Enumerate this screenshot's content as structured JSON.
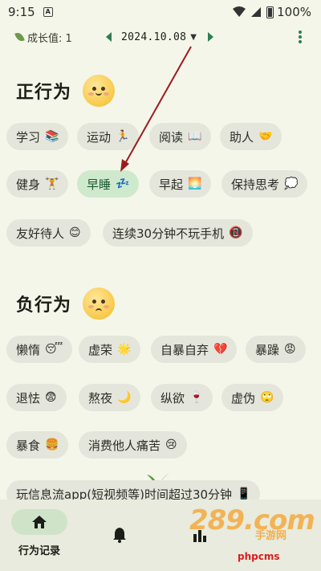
{
  "status_bar": {
    "time": "9:15",
    "notification_letter": "A",
    "battery": "100%"
  },
  "header": {
    "growth_label": "成长值: 1",
    "date": "2024.10.08",
    "icons": [
      "leaf-icon",
      "arrow-left-icon",
      "chevron-down-icon",
      "arrow-right-icon",
      "more-vertical-icon"
    ],
    "accent_color": "#2e7d4f"
  },
  "positive": {
    "title": "正行为",
    "chips": [
      {
        "label": "学习",
        "emoji": "📚",
        "selected": false
      },
      {
        "label": "运动",
        "emoji": "🏃",
        "selected": false
      },
      {
        "label": "阅读",
        "emoji": "📖",
        "selected": false
      },
      {
        "label": "助人",
        "emoji": "🤝",
        "selected": false
      },
      {
        "label": "健身",
        "emoji": "🏋",
        "selected": false
      },
      {
        "label": "早睡",
        "emoji": "💤",
        "selected": true
      },
      {
        "label": "早起",
        "emoji": "🌅",
        "selected": false
      },
      {
        "label": "保持思考",
        "emoji": "💭",
        "selected": false
      },
      {
        "label": "友好待人",
        "emoji": "😊",
        "selected": false
      },
      {
        "label": "连续30分钟不玩手机",
        "emoji": "📵",
        "selected": false
      }
    ]
  },
  "negative": {
    "title": "负行为",
    "chips": [
      {
        "label": "懒惰",
        "emoji": "😴"
      },
      {
        "label": "虚荣",
        "emoji": "🌟"
      },
      {
        "label": "自暴自弃",
        "emoji": "💔"
      },
      {
        "label": "暴躁",
        "emoji": "😡"
      },
      {
        "label": "退怯",
        "emoji": "😨"
      },
      {
        "label": "熬夜",
        "emoji": "🌙"
      },
      {
        "label": "纵欲",
        "emoji": "🍷"
      },
      {
        "label": "虚伪",
        "emoji": "🙄"
      },
      {
        "label": "暴食",
        "emoji": "🍔"
      },
      {
        "label": "消费他人痛苦",
        "emoji": "😢"
      },
      {
        "label": "玩信息流app(短视频等)时间超过30分钟",
        "emoji": "📱"
      }
    ]
  },
  "bottom_nav": {
    "items": [
      {
        "label": "行为记录",
        "icon": "home-icon",
        "active": true
      },
      {
        "label": "",
        "icon": "bell-icon",
        "active": false
      },
      {
        "label": "",
        "icon": "stats-icon",
        "active": false
      }
    ]
  },
  "watermark": {
    "logo": "289.com",
    "subtitle": "手游网",
    "url": "phpcms"
  }
}
